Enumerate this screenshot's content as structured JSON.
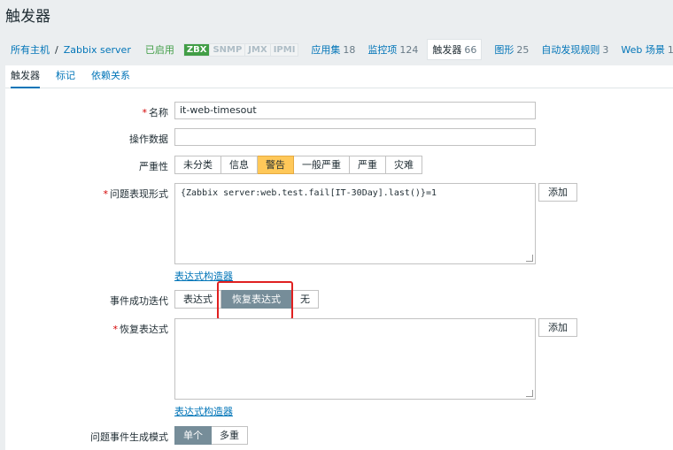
{
  "page": {
    "title": "触发器"
  },
  "breadcrumb": {
    "all_hosts": "所有主机",
    "separator": "/",
    "host": "Zabbix server",
    "status": "已启用",
    "badges": [
      "ZBX",
      "SNMP",
      "JMX",
      "IPMI"
    ],
    "links": [
      {
        "label": "应用集",
        "count": "18"
      },
      {
        "label": "监控项",
        "count": "124"
      },
      {
        "label": "触发器",
        "count": "66"
      },
      {
        "label": "图形",
        "count": "25"
      },
      {
        "label": "自动发现规则",
        "count": "3"
      },
      {
        "label": "Web 场景",
        "count": "1"
      }
    ]
  },
  "tabs": [
    "触发器",
    "标记",
    "依赖关系"
  ],
  "form": {
    "name_label": "名称",
    "name_value": "it-web-timesout",
    "opdata_label": "操作数据",
    "opdata_value": "",
    "severity_label": "严重性",
    "severity_options": [
      "未分类",
      "信息",
      "警告",
      "一般严重",
      "严重",
      "灾难"
    ],
    "severity_selected": "警告",
    "expression_label": "问题表现形式",
    "expression_value": "{Zabbix server:web.test.fail[IT-30Day].last()}=1",
    "add_label": "添加",
    "constructor_link": "表达式构造器",
    "ok_event_label": "事件成功迭代",
    "ok_event_options": [
      "表达式",
      "恢复表达式",
      "无"
    ],
    "ok_event_selected": "恢复表达式",
    "recovery_label": "恢复表达式",
    "recovery_value": "",
    "recovery_add_label": "添加",
    "recovery_constructor_link": "表达式构造器",
    "mode_label": "问题事件生成模式",
    "mode_options": [
      "单个",
      "多重"
    ],
    "mode_selected": "单个"
  },
  "colors": {
    "accent": "#0275b8",
    "warning": "#ffc859",
    "selected": "#768d99",
    "enabled": "#429e47",
    "highlight": "#e02020"
  }
}
